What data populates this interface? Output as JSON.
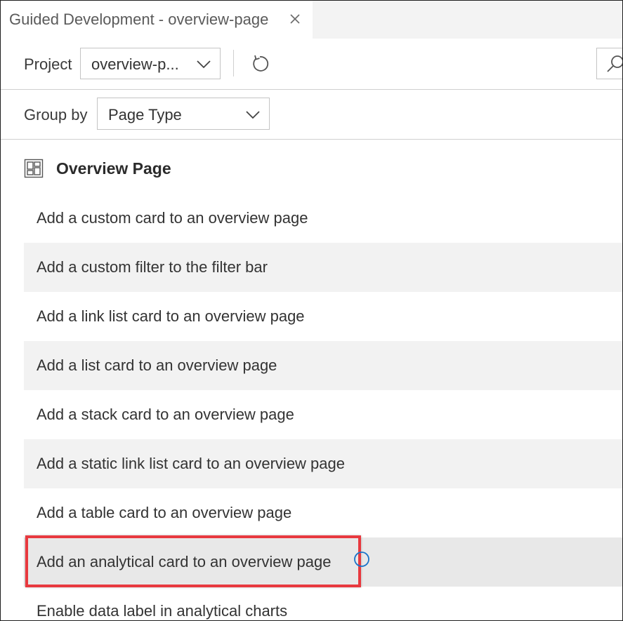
{
  "tab": {
    "title": "Guided Development - overview-page"
  },
  "toolbar": {
    "project_label": "Project",
    "project_value": "overview-p..."
  },
  "groupbar": {
    "group_label": "Group by",
    "group_value": "Page Type"
  },
  "section": {
    "title": "Overview Page"
  },
  "items": [
    {
      "label": "Add a custom card to an overview page"
    },
    {
      "label": "Add a custom filter to the filter bar"
    },
    {
      "label": "Add a link list card to an overview page"
    },
    {
      "label": "Add a list card to an overview page"
    },
    {
      "label": "Add a stack card to an overview page"
    },
    {
      "label": "Add a static link list card to an overview page"
    },
    {
      "label": "Add a table card to an overview page"
    },
    {
      "label": "Add an analytical card to an overview page"
    },
    {
      "label": "Enable data label in analytical charts"
    }
  ],
  "colors": {
    "highlight": "#e8393f",
    "info_accent": "#1a73c9"
  }
}
